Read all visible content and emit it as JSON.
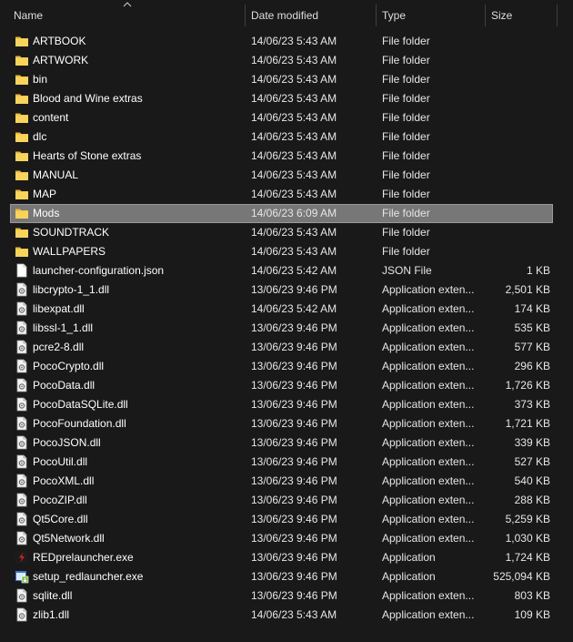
{
  "header": {
    "name": "Name",
    "date": "Date modified",
    "type": "Type",
    "size": "Size"
  },
  "colors": {
    "background": "#191919",
    "folder": "#f8d45c",
    "selected": "#777777"
  },
  "files": [
    {
      "name": "ARTBOOK",
      "date": "14/06/23 5:43 AM",
      "type": "File folder",
      "size": "",
      "icon": "folder-icon"
    },
    {
      "name": "ARTWORK",
      "date": "14/06/23 5:43 AM",
      "type": "File folder",
      "size": "",
      "icon": "folder-icon"
    },
    {
      "name": "bin",
      "date": "14/06/23 5:43 AM",
      "type": "File folder",
      "size": "",
      "icon": "folder-icon"
    },
    {
      "name": "Blood and Wine extras",
      "date": "14/06/23 5:43 AM",
      "type": "File folder",
      "size": "",
      "icon": "folder-icon"
    },
    {
      "name": "content",
      "date": "14/06/23 5:43 AM",
      "type": "File folder",
      "size": "",
      "icon": "folder-icon"
    },
    {
      "name": "dlc",
      "date": "14/06/23 5:43 AM",
      "type": "File folder",
      "size": "",
      "icon": "folder-icon"
    },
    {
      "name": "Hearts of Stone extras",
      "date": "14/06/23 5:43 AM",
      "type": "File folder",
      "size": "",
      "icon": "folder-icon"
    },
    {
      "name": "MANUAL",
      "date": "14/06/23 5:43 AM",
      "type": "File folder",
      "size": "",
      "icon": "folder-icon"
    },
    {
      "name": "MAP",
      "date": "14/06/23 5:43 AM",
      "type": "File folder",
      "size": "",
      "icon": "folder-icon"
    },
    {
      "name": "Mods",
      "date": "14/06/23 6:09 AM",
      "type": "File folder",
      "size": "",
      "icon": "folder-icon",
      "selected": true
    },
    {
      "name": "SOUNDTRACK",
      "date": "14/06/23 5:43 AM",
      "type": "File folder",
      "size": "",
      "icon": "folder-icon"
    },
    {
      "name": "WALLPAPERS",
      "date": "14/06/23 5:43 AM",
      "type": "File folder",
      "size": "",
      "icon": "folder-icon"
    },
    {
      "name": "launcher-configuration.json",
      "date": "14/06/23 5:42 AM",
      "type": "JSON File",
      "size": "1 KB",
      "icon": "document-icon"
    },
    {
      "name": "libcrypto-1_1.dll",
      "date": "13/06/23 9:46 PM",
      "type": "Application exten...",
      "size": "2,501 KB",
      "icon": "dll-icon"
    },
    {
      "name": "libexpat.dll",
      "date": "14/06/23 5:42 AM",
      "type": "Application exten...",
      "size": "174 KB",
      "icon": "dll-icon"
    },
    {
      "name": "libssl-1_1.dll",
      "date": "13/06/23 9:46 PM",
      "type": "Application exten...",
      "size": "535 KB",
      "icon": "dll-icon"
    },
    {
      "name": "pcre2-8.dll",
      "date": "13/06/23 9:46 PM",
      "type": "Application exten...",
      "size": "577 KB",
      "icon": "dll-icon"
    },
    {
      "name": "PocoCrypto.dll",
      "date": "13/06/23 9:46 PM",
      "type": "Application exten...",
      "size": "296 KB",
      "icon": "dll-icon"
    },
    {
      "name": "PocoData.dll",
      "date": "13/06/23 9:46 PM",
      "type": "Application exten...",
      "size": "1,726 KB",
      "icon": "dll-icon"
    },
    {
      "name": "PocoDataSQLite.dll",
      "date": "13/06/23 9:46 PM",
      "type": "Application exten...",
      "size": "373 KB",
      "icon": "dll-icon"
    },
    {
      "name": "PocoFoundation.dll",
      "date": "13/06/23 9:46 PM",
      "type": "Application exten...",
      "size": "1,721 KB",
      "icon": "dll-icon"
    },
    {
      "name": "PocoJSON.dll",
      "date": "13/06/23 9:46 PM",
      "type": "Application exten...",
      "size": "339 KB",
      "icon": "dll-icon"
    },
    {
      "name": "PocoUtil.dll",
      "date": "13/06/23 9:46 PM",
      "type": "Application exten...",
      "size": "527 KB",
      "icon": "dll-icon"
    },
    {
      "name": "PocoXML.dll",
      "date": "13/06/23 9:46 PM",
      "type": "Application exten...",
      "size": "540 KB",
      "icon": "dll-icon"
    },
    {
      "name": "PocoZIP.dll",
      "date": "13/06/23 9:46 PM",
      "type": "Application exten...",
      "size": "288 KB",
      "icon": "dll-icon"
    },
    {
      "name": "Qt5Core.dll",
      "date": "13/06/23 9:46 PM",
      "type": "Application exten...",
      "size": "5,259 KB",
      "icon": "dll-icon"
    },
    {
      "name": "Qt5Network.dll",
      "date": "13/06/23 9:46 PM",
      "type": "Application exten...",
      "size": "1,030 KB",
      "icon": "dll-icon"
    },
    {
      "name": "REDprelauncher.exe",
      "date": "13/06/23 9:46 PM",
      "type": "Application",
      "size": "1,724 KB",
      "icon": "red-app-icon"
    },
    {
      "name": "setup_redlauncher.exe",
      "date": "13/06/23 9:46 PM",
      "type": "Application",
      "size": "525,094 KB",
      "icon": "installer-icon"
    },
    {
      "name": "sqlite.dll",
      "date": "13/06/23 9:46 PM",
      "type": "Application exten...",
      "size": "803 KB",
      "icon": "dll-icon"
    },
    {
      "name": "zlib1.dll",
      "date": "14/06/23 5:43 AM",
      "type": "Application exten...",
      "size": "109 KB",
      "icon": "dll-icon"
    }
  ]
}
